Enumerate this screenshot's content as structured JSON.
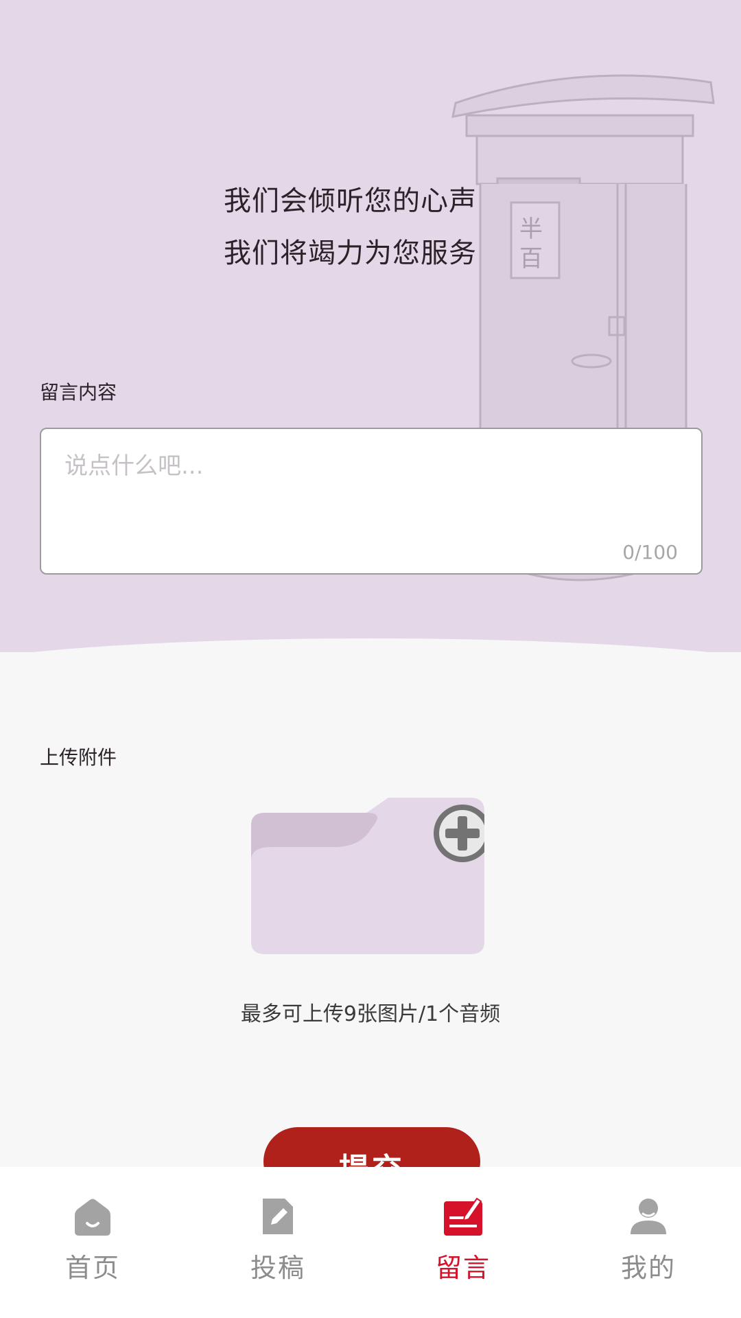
{
  "hero": {
    "slogan_line1": "我们会倾听您的心声",
    "slogan_line2": "我们将竭力为您服务"
  },
  "message": {
    "label": "留言内容",
    "placeholder": "说点什么吧...",
    "value": "",
    "counter": "0/100"
  },
  "upload": {
    "label": "上传附件",
    "hint": "最多可上传9张图片/1个音频"
  },
  "submit_label": "提交",
  "tabbar": {
    "active_color": "#d6112a",
    "inactive_color": "#8c8c8c",
    "items": [
      {
        "label": "首页",
        "icon": "home-icon"
      },
      {
        "label": "投稿",
        "icon": "edit-document-icon"
      },
      {
        "label": "留言",
        "icon": "message-edit-icon",
        "active": true
      },
      {
        "label": "我的",
        "icon": "user-icon"
      }
    ]
  }
}
